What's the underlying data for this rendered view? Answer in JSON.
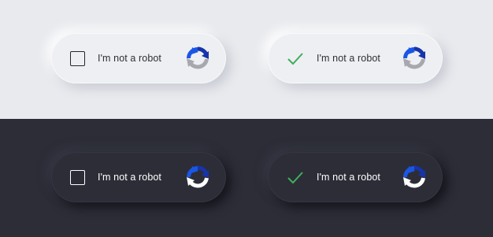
{
  "colors": {
    "light_background": "#e9eaee",
    "dark_background": "#2c2d37",
    "check_green": "#3fae5c",
    "logo_blue": "#1a56e6",
    "logo_dark_blue": "#1734a8",
    "logo_gray_light_theme": "#a7a8ae",
    "logo_gray_dark_theme": "#ffffff"
  },
  "widgets": [
    {
      "theme": "light",
      "state": "unchecked",
      "label": "I'm not a robot",
      "icon": "recaptcha-logo-icon"
    },
    {
      "theme": "light",
      "state": "checked",
      "label": "I'm not a robot",
      "icon": "recaptcha-logo-icon"
    },
    {
      "theme": "dark",
      "state": "unchecked",
      "label": "I'm not a robot",
      "icon": "recaptcha-logo-icon"
    },
    {
      "theme": "dark",
      "state": "checked",
      "label": "I'm not a robot",
      "icon": "recaptcha-logo-icon"
    }
  ]
}
